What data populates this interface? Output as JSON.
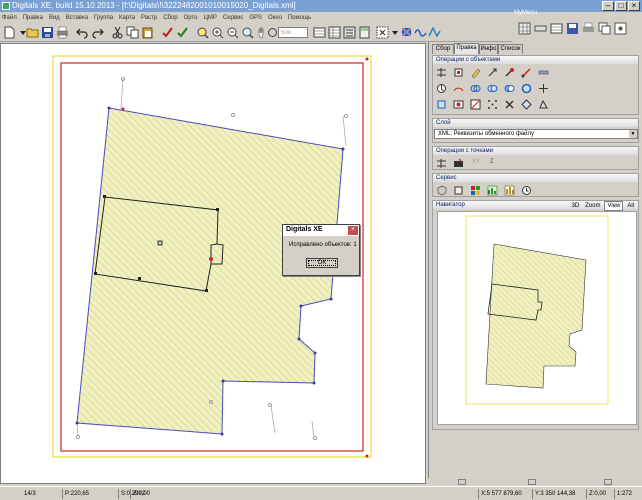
{
  "window": {
    "title": "Digitals XE, build 15.10.2013 - [f:\\Digitals\\!\\3222482001010015020_Digitals.xml]",
    "menu_label": "MyMenu"
  },
  "menu": [
    "Файл",
    "Правка",
    "Вид",
    "Вставка",
    "Группа",
    "Карта",
    "Растр",
    "Сбор",
    "Орто",
    "ЦМР",
    "Сервис",
    "GPS",
    "Окно",
    "Помощь"
  ],
  "toolbar": {
    "scale_value": "500"
  },
  "dialog": {
    "title": "Digitals XE",
    "message": "Исправлено объектов: 1",
    "ok_label": "OK"
  },
  "panel": {
    "tabs": [
      "Сбор",
      "Правка",
      "Инфо",
      "Список"
    ],
    "active_tab": "Правка",
    "sections": {
      "objects": "Операции с объектами",
      "layer": "Слой",
      "points": "Операции с точками",
      "service": "Сервис",
      "navigator": "Навигатор"
    },
    "layer_value": "XML: Реквизиты обменного файлу",
    "points_labels": [
      "XY",
      "Z"
    ],
    "navigator_tabs": [
      "3D",
      "Zoom",
      "View",
      "All"
    ],
    "navigator_active": "View"
  },
  "status": {
    "page": "14/3",
    "perimeter": "P:220,65",
    "area": "S:0,2992",
    "z_left": "Z:0,00",
    "x": "X:5 577 879,60",
    "y": "Y:3 350 144,38",
    "z_right": "Z:0,00",
    "scale": "1:272"
  },
  "colors": {
    "parcel_fill": "#f0f0c0",
    "hatch": "#c8c880",
    "parcel_edge": "#4a4ac0",
    "frame_red": "#d02020",
    "frame_yellow": "#f0e060"
  }
}
